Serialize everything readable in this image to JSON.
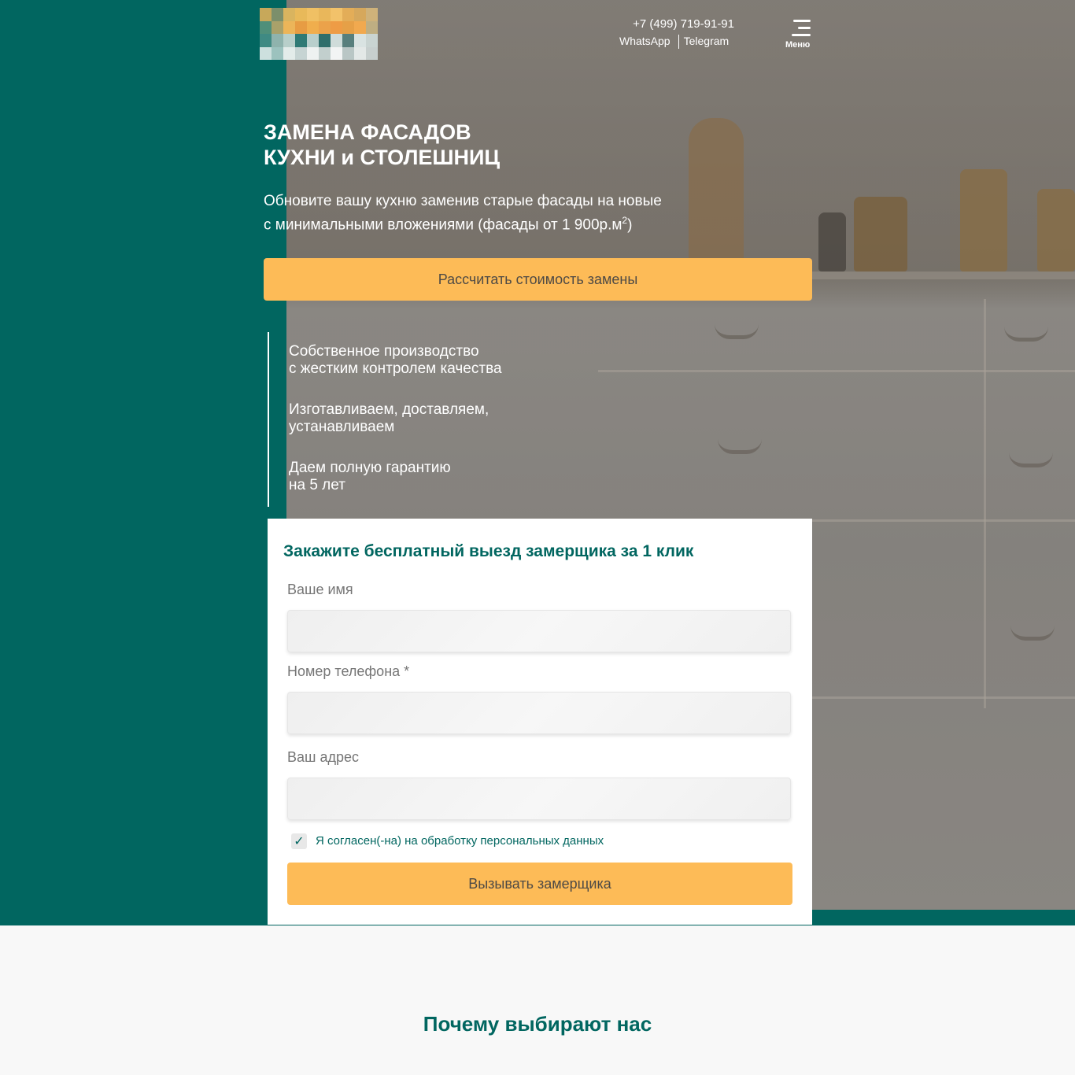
{
  "header": {
    "phone": "+7 (499) 719-91-91",
    "whatsapp": "WhatsApp",
    "telegram": "Telegram",
    "menu_label": "Меню"
  },
  "hero": {
    "title_line1": "ЗАМЕНА ФАСАДОВ",
    "title_line2": "КУХНИ и СТОЛЕШНИЦ",
    "subtitle_line1": "Обновите вашу кухню заменив старые фасады на новые",
    "subtitle_line2": "с минимальными вложениями (фасады от 1 900р.м",
    "subtitle_sup": "2",
    "subtitle_end": ")",
    "cta_label": "Рассчитать стоимость замены",
    "features": [
      {
        "line1": "Собственное производство",
        "line2": "с жестким контролем качества"
      },
      {
        "line1": "Изготавливаем, доставляем,",
        "line2": "устанавливаем"
      },
      {
        "line1": "Даем полную гарантию",
        "line2": "на 5 лет"
      }
    ]
  },
  "form": {
    "title": "Закажите бесплатный выезд замерщика за 1 клик",
    "name_label": "Ваше имя",
    "phone_label": "Номер телефона *",
    "address_label": "Ваш адрес",
    "consent_label": "Я согласен(-на) на обработку персональных данных",
    "consent_checked": true,
    "submit_label": "Вызывать замерщика"
  },
  "section_title": "Почему выбирают нас",
  "colors": {
    "brand_green": "#016660",
    "accent_orange": "#fdbb57"
  }
}
